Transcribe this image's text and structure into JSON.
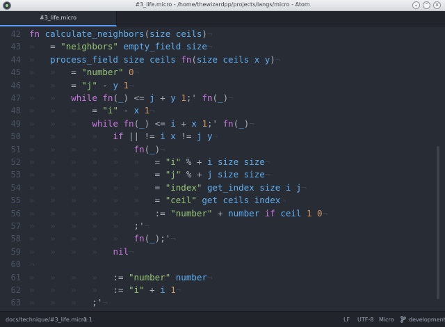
{
  "window": {
    "title": "#3_life.micro - /home/thewizardpp/projects/langs/micro - Atom",
    "app_icon": "atom-icon",
    "buttons": [
      "minimize-icon",
      "maximize-icon",
      "close-icon"
    ],
    "button_glyphs": {
      "min": "⌄",
      "max": "⌃",
      "close": "×"
    }
  },
  "tabs": [
    {
      "label": "#3_life.micro",
      "active": true
    }
  ],
  "editor": {
    "theme": {
      "background": "#282c34",
      "keyword": "#c678dd",
      "string": "#98c379",
      "number": "#d19a66",
      "identifier": "#61afef"
    },
    "lines": [
      {
        "n": "42",
        "text": "fn calculate_neighbors(size ceils)¬"
      },
      {
        "n": "43",
        "text": "»   = \"neighbors\" empty_field size¬"
      },
      {
        "n": "44",
        "text": "»   process_field size ceils fn(size ceils x y)¬"
      },
      {
        "n": "45",
        "text": "»   »   = \"number\" 0¬"
      },
      {
        "n": "46",
        "text": "»   »   = \"j\" - y 1¬"
      },
      {
        "n": "47",
        "text": "»   »   while fn(_) <= j + y 1;' fn(_)¬"
      },
      {
        "n": "48",
        "text": "»   »   »   = \"i\" - x 1¬"
      },
      {
        "n": "49",
        "text": "»   »   »   while fn(_) <= i + x 1;' fn(_)¬"
      },
      {
        "n": "50",
        "text": "»   »   »   »   if || != i x != j y¬"
      },
      {
        "n": "51",
        "text": "»   »   »   »   »   fn(_)¬"
      },
      {
        "n": "52",
        "text": "»   »   »   »   »   »   = \"i\" % + i size size¬"
      },
      {
        "n": "53",
        "text": "»   »   »   »   »   »   = \"j\" % + j size size¬"
      },
      {
        "n": "54",
        "text": "»   »   »   »   »   »   = \"index\" get_index size i j¬"
      },
      {
        "n": "55",
        "text": "»   »   »   »   »   »   = \"ceil\" get ceils index¬"
      },
      {
        "n": "56",
        "text": "»   »   »   »   »   »   := \"number\" + number if ceil 1 0¬"
      },
      {
        "n": "57",
        "text": "»   »   »   »   »   ;'¬"
      },
      {
        "n": "58",
        "text": "»   »   »   »   »   fn(_);'¬"
      },
      {
        "n": "59",
        "text": "»   »   »   »   nil¬"
      },
      {
        "n": "60",
        "text": "¬"
      },
      {
        "n": "61",
        "text": "»   »   »   »   := \"number\" number¬"
      },
      {
        "n": "62",
        "text": "»   »   »   »   := \"i\" + i 1¬"
      },
      {
        "n": "63",
        "text": "»   »   »   ;'¬"
      }
    ]
  },
  "statusbar": {
    "path": "docs/technique/#3_life.micro",
    "cursor": "1:1",
    "line_ending": "LF",
    "encoding": "UTF-8",
    "grammar": "Micro",
    "branch_icon": "git-branch-icon",
    "branch": "development"
  }
}
